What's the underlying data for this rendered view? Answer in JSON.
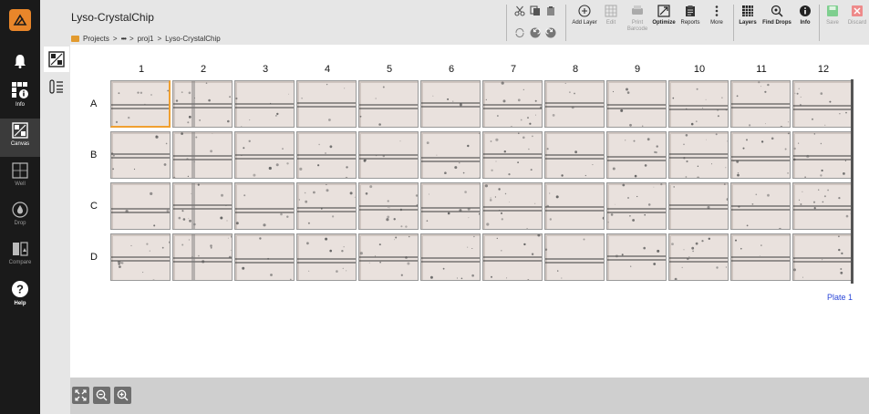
{
  "app": {
    "title": "Lyso-CrystalChip",
    "breadcrumb": [
      "Projects",
      "•••",
      "proj1",
      "Lyso-CrystalChip"
    ],
    "breadcrumb_sep": ">"
  },
  "sidebar": {
    "items": [
      {
        "id": "notifications",
        "label": "",
        "icon": "bell-icon"
      },
      {
        "id": "info",
        "label": "Info",
        "icon": "plate-info-icon"
      },
      {
        "id": "canvas",
        "label": "Canvas",
        "icon": "canvas-icon",
        "active": true
      },
      {
        "id": "well",
        "label": "Well",
        "icon": "well-icon"
      },
      {
        "id": "drop",
        "label": "Drop",
        "icon": "drop-icon"
      },
      {
        "id": "compare",
        "label": "Compare",
        "icon": "compare-icon"
      },
      {
        "id": "help",
        "label": "Help",
        "icon": "help-icon"
      }
    ]
  },
  "toolbar": {
    "add_layer": "Add Layer",
    "edit": "Edit",
    "print": "Print",
    "barcode": "Barcode",
    "optimize": "Optimize",
    "reports": "Reports",
    "more": "More",
    "layers": "Layers",
    "find_drops": "Find Drops",
    "info": "Info",
    "save": "Save",
    "discard": "Discard"
  },
  "plate": {
    "columns": [
      "1",
      "2",
      "3",
      "4",
      "5",
      "6",
      "7",
      "8",
      "9",
      "10",
      "11",
      "12"
    ],
    "rows": [
      "A",
      "B",
      "C",
      "D"
    ],
    "selected": "A1",
    "label": "Plate 1"
  },
  "colors": {
    "accent": "#e8862a",
    "selection": "#f0a030",
    "plate_label": "#2a46d8",
    "save": "#3aa655",
    "discard": "#d9383a"
  }
}
